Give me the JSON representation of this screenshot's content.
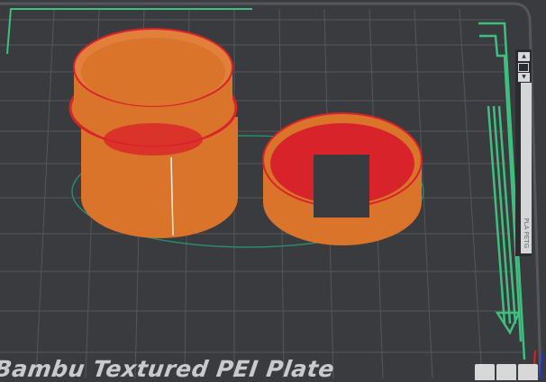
{
  "plate": {
    "name": "Bambu Textured PEI Plate"
  },
  "layer_slider": {
    "filament_label": "PLA PETG",
    "up_icon": "layer-up-icon",
    "down_icon": "layer-down-icon"
  },
  "colors": {
    "bed": "#3a3b3f",
    "grid": "#55565b",
    "outer_wall": "#d9742a",
    "inner": "#d8232a",
    "travel": "#3fbf7f",
    "skirt": "#2a8a6a"
  }
}
